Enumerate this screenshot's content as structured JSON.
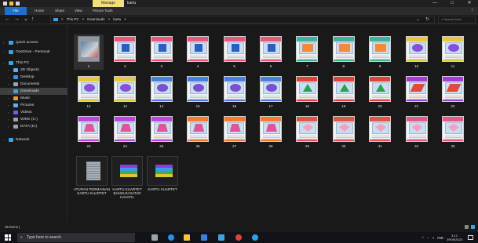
{
  "titlebar": {
    "manage_tab": "Manage",
    "title": "kartu",
    "minimize": "—",
    "maximize": "□",
    "close": "✕"
  },
  "ribbon": {
    "tabs": [
      "File",
      "Home",
      "Share",
      "View",
      "Picture Tools"
    ],
    "help": "?"
  },
  "address": {
    "back": "←",
    "forward": "→",
    "recent": "⌄",
    "up": "↑",
    "path": [
      "This PC",
      "Downloads",
      "kartu"
    ],
    "separator": ">",
    "dropdown": "⌄",
    "refresh": "↻",
    "search_placeholder": "Search kartu"
  },
  "nav": {
    "items": [
      {
        "label": "Quick access",
        "icon": "star-icon",
        "color": "#3da2e6"
      },
      {
        "label": "OneDrive - Personal",
        "icon": "cloud-icon",
        "color": "#3da2e6"
      },
      {
        "label": "This PC",
        "icon": "pc-icon",
        "color": "#3da2e6"
      },
      {
        "label": "3D Objects",
        "icon": "cube-icon",
        "color": "#5ab2e8"
      },
      {
        "label": "Desktop",
        "icon": "desktop-icon",
        "color": "#3d8fe0"
      },
      {
        "label": "Documents",
        "icon": "documents-icon",
        "color": "#9aa4ad"
      },
      {
        "label": "Downloads",
        "icon": "download-icon",
        "color": "#3da2e6"
      },
      {
        "label": "Music",
        "icon": "music-icon",
        "color": "#e09b3d"
      },
      {
        "label": "Pictures",
        "icon": "pictures-icon",
        "color": "#5ab2e8"
      },
      {
        "label": "Videos",
        "icon": "videos-icon",
        "color": "#7a5ae0"
      },
      {
        "label": "WINK (C:)",
        "icon": "drive-icon",
        "color": "#9aa4ad"
      },
      {
        "label": "DATA (D:)",
        "icon": "drive-icon",
        "color": "#9aa4ad"
      },
      {
        "label": "Network",
        "icon": "network-icon",
        "color": "#3da2e6"
      }
    ]
  },
  "files": {
    "cards": [
      {
        "label": "1",
        "band": "#7d8a96",
        "shape": "#4a5a6a",
        "kind": "photo"
      },
      {
        "label": "2",
        "band": "#e8557d",
        "shape": "#2a5fc0",
        "kind": "square"
      },
      {
        "label": "3",
        "band": "#e8557d",
        "shape": "#2a5fc0",
        "kind": "square"
      },
      {
        "label": "4",
        "band": "#e8557d",
        "shape": "#2a5fc0",
        "kind": "square"
      },
      {
        "label": "5",
        "band": "#e8557d",
        "shape": "#2a5fc0",
        "kind": "square"
      },
      {
        "label": "6",
        "band": "#e8557d",
        "shape": "#2a5fc0",
        "kind": "square"
      },
      {
        "label": "7",
        "band": "#3fb0a0",
        "shape": "#f08a3c",
        "kind": "rect"
      },
      {
        "label": "8",
        "band": "#3fb0a0",
        "shape": "#f08a3c",
        "kind": "rect"
      },
      {
        "label": "9",
        "band": "#3fb0a0",
        "shape": "#f08a3c",
        "kind": "rect"
      },
      {
        "label": "10",
        "band": "#e3c83a",
        "shape": "#8a4fd8",
        "kind": "circle"
      },
      {
        "label": "11",
        "band": "#e3c83a",
        "shape": "#8a4fd8",
        "kind": "circle"
      },
      {
        "label": "12",
        "band": "#e3c83a",
        "shape": "#8a4fd8",
        "kind": "circle"
      },
      {
        "label": "13",
        "band": "#e3c83a",
        "shape": "#8a4fd8",
        "kind": "circle"
      },
      {
        "label": "14",
        "band": "#4a7fe0",
        "shape": "#7a4fd0",
        "kind": "circle"
      },
      {
        "label": "15",
        "band": "#4a7fe0",
        "shape": "#7a4fd0",
        "kind": "circle"
      },
      {
        "label": "16",
        "band": "#4a7fe0",
        "shape": "#7a4fd0",
        "kind": "circle"
      },
      {
        "label": "17",
        "band": "#4a7fe0",
        "shape": "#7a4fd0",
        "kind": "circle"
      },
      {
        "label": "18",
        "band": "#e0413a",
        "shape": "#2aa14a",
        "kind": "triangle"
      },
      {
        "label": "19",
        "band": "#e0413a",
        "shape": "#2aa14a",
        "kind": "triangle"
      },
      {
        "label": "20",
        "band": "#e0413a",
        "shape": "#2aa14a",
        "kind": "triangle"
      },
      {
        "label": "21",
        "band": "#a23fd0",
        "shape": "#e04a3a",
        "kind": "parallelogram"
      },
      {
        "label": "22",
        "band": "#a23fd0",
        "shape": "#e04a3a",
        "kind": "parallelogram"
      },
      {
        "label": "23",
        "band": "#b84ad8",
        "shape": "#e0559a",
        "kind": "trapezoid"
      },
      {
        "label": "24",
        "band": "#b84ad8",
        "shape": "#e0559a",
        "kind": "trapezoid"
      },
      {
        "label": "25",
        "band": "#b84ad8",
        "shape": "#e0559a",
        "kind": "trapezoid"
      },
      {
        "label": "26",
        "band": "#f07a3a",
        "shape": "#e0559a",
        "kind": "trapezoid"
      },
      {
        "label": "27",
        "band": "#f07a3a",
        "shape": "#e0559a",
        "kind": "trapezoid"
      },
      {
        "label": "28",
        "band": "#f07a3a",
        "shape": "#e0559a",
        "kind": "trapezoid"
      },
      {
        "label": "29",
        "band": "#e0554a",
        "shape": "#e0559a",
        "kind": "kite"
      },
      {
        "label": "30",
        "band": "#e0554a",
        "shape": "#e0559a",
        "kind": "kite"
      },
      {
        "label": "31",
        "band": "#e0554a",
        "shape": "#e0559a",
        "kind": "kite"
      },
      {
        "label": "32",
        "band": "#e05a8a",
        "shape": "#e0559a",
        "kind": "kite"
      },
      {
        "label": "33",
        "band": "#e05a8a",
        "shape": "#e0559a",
        "kind": "kite"
      }
    ],
    "documents": [
      {
        "label": "ATURAN PERMAINAN KARTU KUARTET",
        "kind": "doc"
      },
      {
        "label": "KARTU KUARTET BANGUN DATAR HAYATIL",
        "kind": "rar"
      },
      {
        "label": "KARTU KUARTET",
        "kind": "rar"
      }
    ]
  },
  "status": {
    "count": "36 items",
    "separator": "|"
  },
  "taskbar": {
    "search_placeholder": "Type here to search",
    "apps": [
      {
        "name": "task-view-icon",
        "color": "#9aa4ad"
      },
      {
        "name": "edge-icon",
        "color": "#2f8fe0"
      },
      {
        "name": "file-explorer-icon",
        "color": "#f4c542"
      },
      {
        "name": "store-icon",
        "color": "#3d7fe0"
      },
      {
        "name": "mail-icon",
        "color": "#3da2e6"
      },
      {
        "name": "chrome-icon",
        "color": "#e0413a"
      },
      {
        "name": "browser-icon",
        "color": "#2aa1e8"
      }
    ],
    "tray_arrow": "^",
    "lang": "IND",
    "time": "3:12",
    "date": "29/09/2023"
  }
}
